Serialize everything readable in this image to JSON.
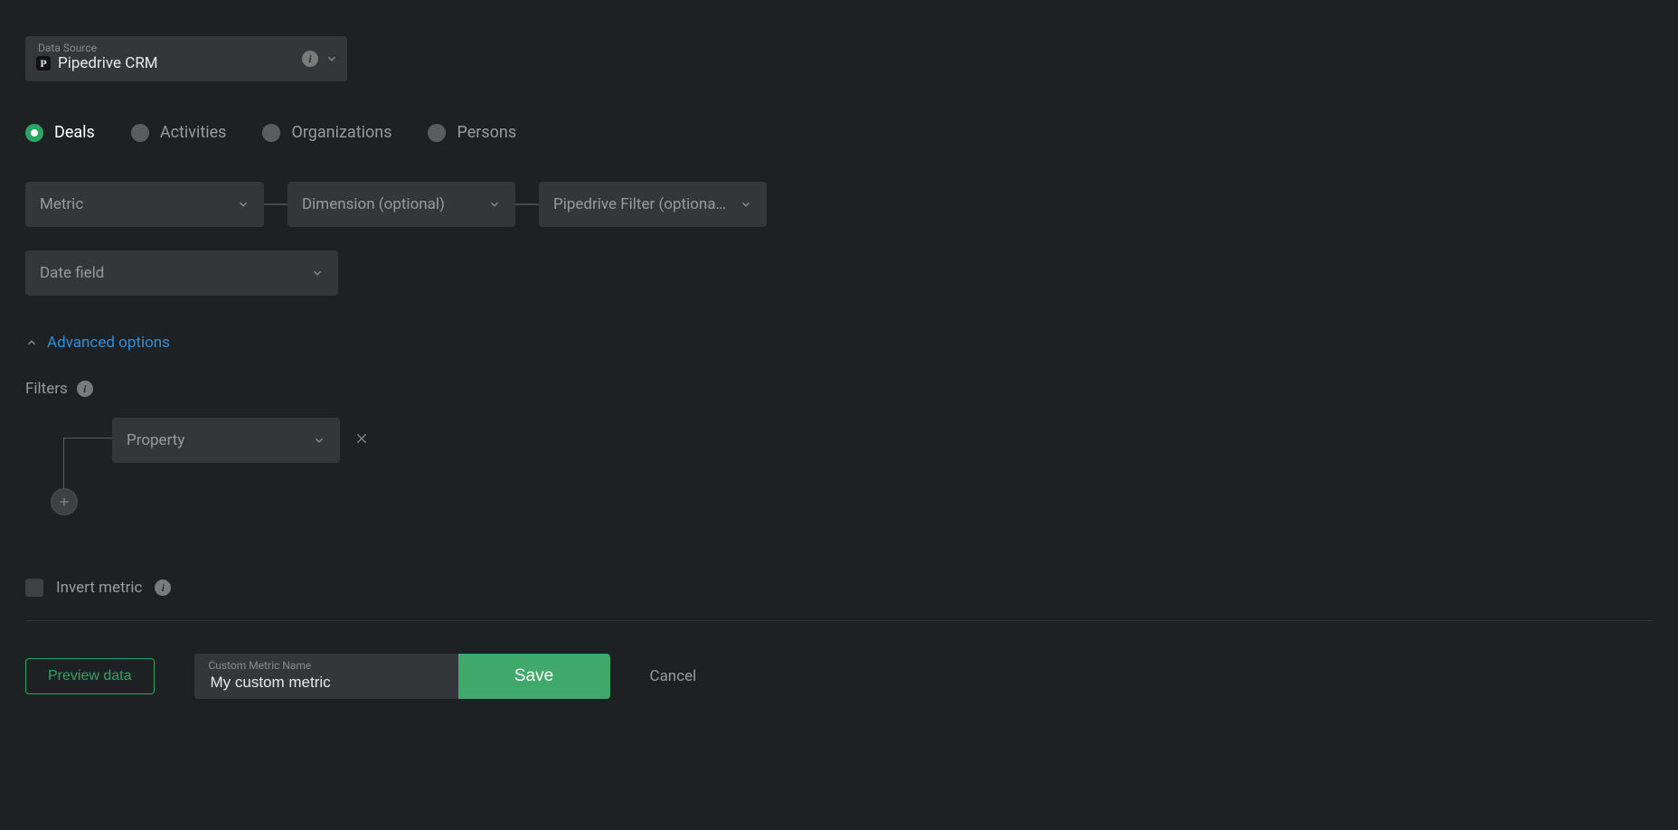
{
  "datasource": {
    "label": "Data Source",
    "value": "Pipedrive CRM",
    "icon_letter": "P"
  },
  "tabs": [
    {
      "label": "Deals",
      "selected": true
    },
    {
      "label": "Activities",
      "selected": false
    },
    {
      "label": "Organizations",
      "selected": false
    },
    {
      "label": "Persons",
      "selected": false
    }
  ],
  "selects": {
    "metric": "Metric",
    "dimension": "Dimension (optional)",
    "pipedrive_filter": "Pipedrive Filter (optiona…",
    "date_field": "Date field",
    "property": "Property"
  },
  "advanced": {
    "toggle_label": "Advanced options",
    "filters_label": "Filters"
  },
  "invert": {
    "label": "Invert metric"
  },
  "footer": {
    "preview_label": "Preview data",
    "custom_name_label": "Custom Metric Name",
    "custom_name_value": "My custom metric",
    "save_label": "Save",
    "cancel_label": "Cancel"
  },
  "colors": {
    "accent_green": "#29a566",
    "link_blue": "#2f8fd9"
  }
}
